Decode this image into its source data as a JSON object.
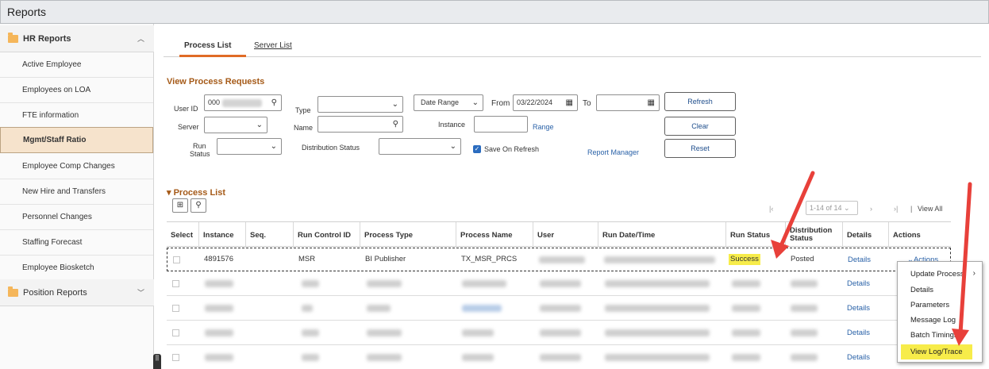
{
  "app": {
    "title": "Reports"
  },
  "sidebar": {
    "hr_reports": {
      "label": "HR Reports",
      "chevron": "︿"
    },
    "items": [
      {
        "label": "Active Employee"
      },
      {
        "label": "Employees on LOA"
      },
      {
        "label": "FTE information"
      },
      {
        "label": "Mgmt/Staff Ratio",
        "active": true
      },
      {
        "label": "Employee Comp Changes"
      },
      {
        "label": "New Hire and Transfers"
      },
      {
        "label": "Personnel Changes"
      },
      {
        "label": "Staffing Forecast"
      },
      {
        "label": "Employee Biosketch"
      }
    ],
    "position_reports": {
      "label": "Position Reports",
      "chevron": "﹀"
    },
    "handle": "||"
  },
  "tabs": [
    {
      "label": "Process List"
    },
    {
      "label": "Server List"
    }
  ],
  "form": {
    "section_title": "View Process Requests",
    "user_id_label": "User ID",
    "user_id_value": "000",
    "type_label": "Type",
    "range_select": "Date Range",
    "from_label": "From",
    "from_value": "03/22/2024",
    "to_label": "To",
    "to_value": "",
    "server_label": "Server",
    "name_label": "Name",
    "instance_label": "Instance",
    "range_link": "Range",
    "run_status_label_1": "Run",
    "run_status_label_2": "Status",
    "distribution_status_label": "Distribution Status",
    "save_on_refresh_label": "Save On Refresh",
    "report_manager_link": "Report Manager",
    "refresh_button": "Refresh",
    "clear_button": "Clear",
    "reset_button": "Reset"
  },
  "process_list": {
    "title": "Process List",
    "pager_text": "1-14 of 14",
    "view_all": "View All",
    "columns": [
      {
        "label": "Select"
      },
      {
        "label": "Instance"
      },
      {
        "label": "Seq."
      },
      {
        "label": "Run Control ID"
      },
      {
        "label": "Process Type"
      },
      {
        "label": "Process Name"
      },
      {
        "label": "User"
      },
      {
        "label": "Run Date/Time"
      },
      {
        "label": "Run Status"
      },
      {
        "label": "Distribution Status"
      },
      {
        "label": "Details"
      },
      {
        "label": "Actions"
      }
    ],
    "first_row": {
      "instance": "4891576",
      "run_control_id": "MSR",
      "process_type": "BI Publisher",
      "process_name": "TX_MSR_PRCS",
      "run_status": "Success",
      "distribution_status": "Posted",
      "details": "Details",
      "actions": "Actions"
    },
    "details_link": "Details"
  },
  "actions_menu": {
    "items": [
      {
        "label": "Update Process"
      },
      {
        "label": "Details"
      },
      {
        "label": "Parameters"
      },
      {
        "label": "Message Log"
      },
      {
        "label": "Batch Timings"
      },
      {
        "label": "View Log/Trace",
        "highlighted": true
      }
    ]
  },
  "colors": {
    "accent": "#e06b26",
    "highlight": "#f7ec4a",
    "arrow": "#e8403a",
    "link": "#2a62a8"
  }
}
